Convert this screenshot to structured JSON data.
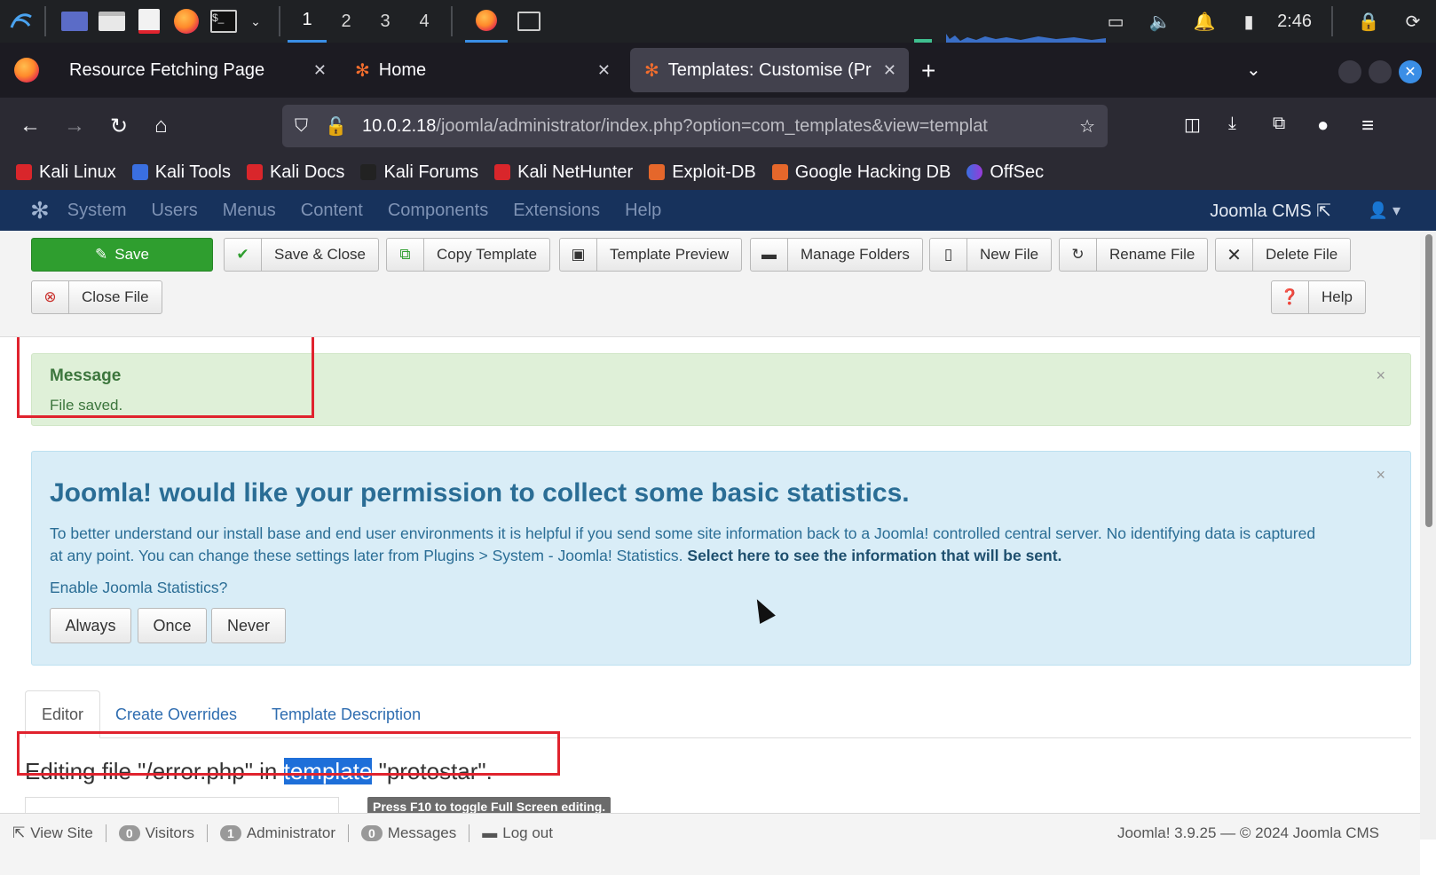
{
  "taskbar": {
    "workspaces": [
      "1",
      "2",
      "3",
      "4"
    ],
    "active_workspace": "1",
    "clock": "2:46"
  },
  "browser": {
    "tabs": [
      {
        "title": "Resource Fetching Page",
        "active": false
      },
      {
        "title": "Home",
        "active": false
      },
      {
        "title": "Templates: Customise (Pr",
        "active": true
      }
    ],
    "url_host": "10.0.2.18",
    "url_path": "/joomla/administrator/index.php?option=com_templates&view=templat",
    "bookmarks": [
      "Kali Linux",
      "Kali Tools",
      "Kali Docs",
      "Kali Forums",
      "Kali NetHunter",
      "Exploit-DB",
      "Google Hacking DB",
      "OffSec"
    ]
  },
  "joomla_header": {
    "menu": [
      "System",
      "Users",
      "Menus",
      "Content",
      "Components",
      "Extensions",
      "Help"
    ],
    "site_name": "Joomla CMS"
  },
  "toolbar": {
    "save": "Save",
    "save_close": "Save & Close",
    "copy_template": "Copy Template",
    "template_preview": "Template Preview",
    "manage_folders": "Manage Folders",
    "new_file": "New File",
    "rename_file": "Rename File",
    "delete_file": "Delete File",
    "close_file": "Close File",
    "help": "Help"
  },
  "message": {
    "heading": "Message",
    "text": "File saved.",
    "close": "×"
  },
  "stats": {
    "title": "Joomla! would like your permission to collect some basic statistics.",
    "description": "To better understand our install base and end user environments it is helpful if you send some site information back to a Joomla! controlled central server. No identifying data is captured at any point. You can change these settings later from Plugins > System - Joomla! Statistics.",
    "link": "Select here to see the information that will be sent.",
    "question": "Enable Joomla Statistics?",
    "buttons": [
      "Always",
      "Once",
      "Never"
    ],
    "close": "×"
  },
  "content_tabs": [
    "Editor",
    "Create Overrides",
    "Template Description"
  ],
  "editing": {
    "before": "Editing file \"/error.php\" in ",
    "highlight": "template",
    "after": " \"protostar\"."
  },
  "f10_hint": "Press F10 to toggle Full Screen editing.",
  "statusbar": {
    "view_site": "View Site",
    "visitors_count": "0",
    "visitors": "Visitors",
    "admin_count": "1",
    "admin": "Administrator",
    "messages_count": "0",
    "messages": "Messages",
    "logout": "Log out",
    "version": "Joomla! 3.9.25",
    "copyright": "© 2024 Joomla CMS"
  }
}
